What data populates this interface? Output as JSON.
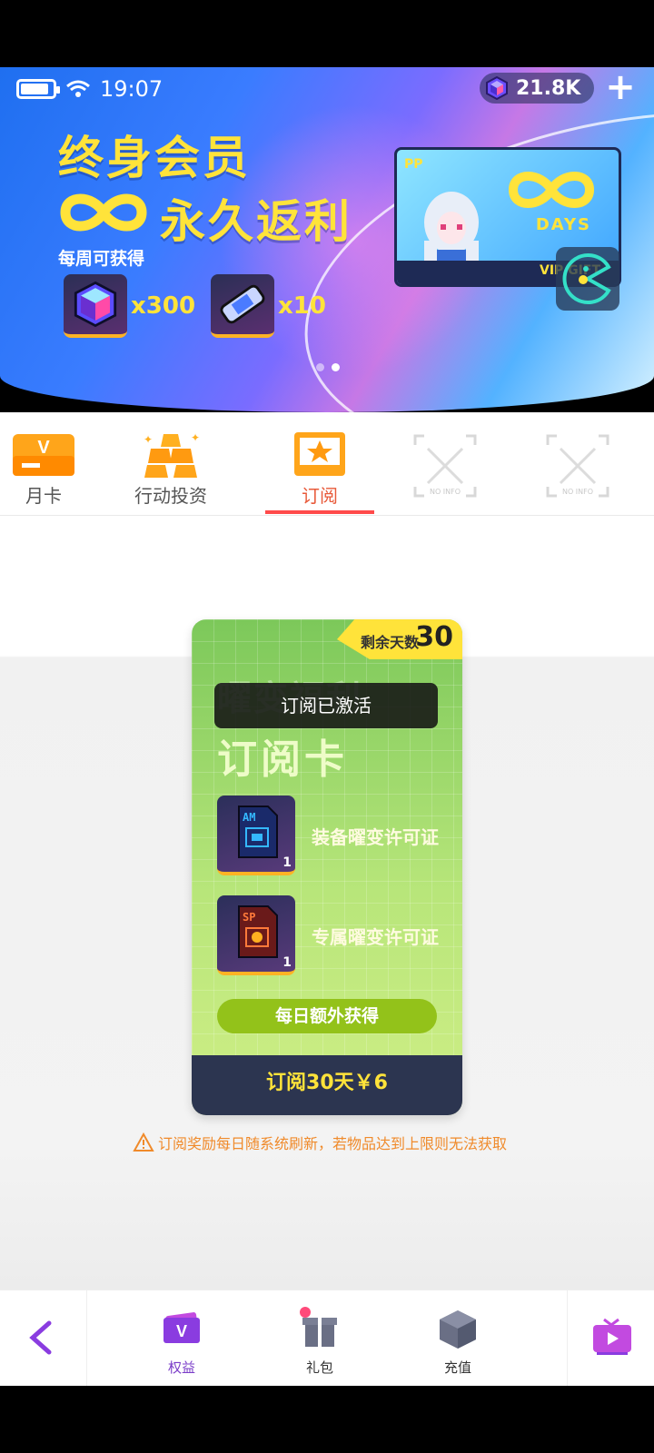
{
  "status_bar": {
    "time": "19:07"
  },
  "currency": {
    "amount": "21.8K",
    "icon": "gem-icon"
  },
  "banner": {
    "title_line1": "终身会员",
    "title_line2": "永久返利",
    "weekly_label": "每周可获得",
    "rewards": [
      {
        "icon": "cube-gem-icon",
        "qty": "x300"
      },
      {
        "icon": "capsule-icon",
        "qty": "x10"
      }
    ],
    "vip_card": {
      "pp": "PP",
      "days": "DAYS",
      "strip": "VIP GIFT"
    },
    "page_indicator": {
      "total": 2,
      "current": 2
    }
  },
  "tabs": [
    {
      "label": "月卡",
      "icon": "monthly-card-icon",
      "active": false
    },
    {
      "label": "行动投资",
      "icon": "gold-bars-icon",
      "active": false
    },
    {
      "label": "订阅",
      "icon": "subscription-icon",
      "active": true
    },
    {
      "label": "NO INFO",
      "icon": "no-info-icon",
      "active": false
    },
    {
      "label": "NO INFO",
      "icon": "no-info-icon",
      "active": false
    }
  ],
  "subscription_card": {
    "remaining_label": "剩余天数",
    "remaining_days": "30",
    "ghost_title": "曜变福利",
    "title": "订阅卡",
    "items": [
      {
        "label": "装备曜变许可证",
        "count": "1",
        "tag": "AM",
        "color": "#2a7bff"
      },
      {
        "label": "专属曜变许可证",
        "count": "1",
        "tag": "SP",
        "color": "#e0452a"
      }
    ],
    "daily_bonus": "每日额外获得",
    "buy_label": "订阅30天￥6"
  },
  "toast": "订阅已激活",
  "notice": "订阅奖励每日随系统刷新，若物品达到上限则无法获取",
  "bottom_nav": [
    {
      "label": "权益",
      "icon": "vip-perks-icon",
      "active": true
    },
    {
      "label": "礼包",
      "icon": "gift-icon",
      "active": false
    },
    {
      "label": "充值",
      "icon": "recharge-box-icon",
      "active": false
    }
  ],
  "colors": {
    "accent": "#ffe33a",
    "active_tab": "#ff4a4a",
    "nav_active": "#7a3cc8",
    "notice": "#f08a2a"
  }
}
